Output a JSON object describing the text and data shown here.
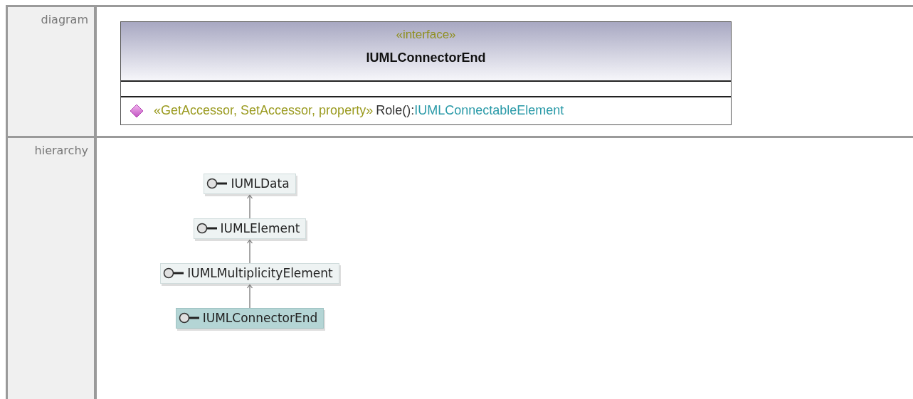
{
  "sections": [
    {
      "kind": "diagram",
      "label": "diagram",
      "class": {
        "stereotype": "«interface»",
        "name": "IUMLConnectorEnd",
        "operations": [
          {
            "stereotypes": "«GetAccessor, SetAccessor, property»",
            "name": "Role():",
            "type": "IUMLConnectableElement"
          }
        ]
      }
    },
    {
      "kind": "hierarchy",
      "label": "hierarchy",
      "nodes": [
        {
          "name": "IUMLData",
          "selected": false
        },
        {
          "name": "IUMLElement",
          "selected": false
        },
        {
          "name": "IUMLMultiplicityElement",
          "selected": false
        },
        {
          "name": "IUMLConnectorEnd",
          "selected": true
        }
      ]
    }
  ]
}
